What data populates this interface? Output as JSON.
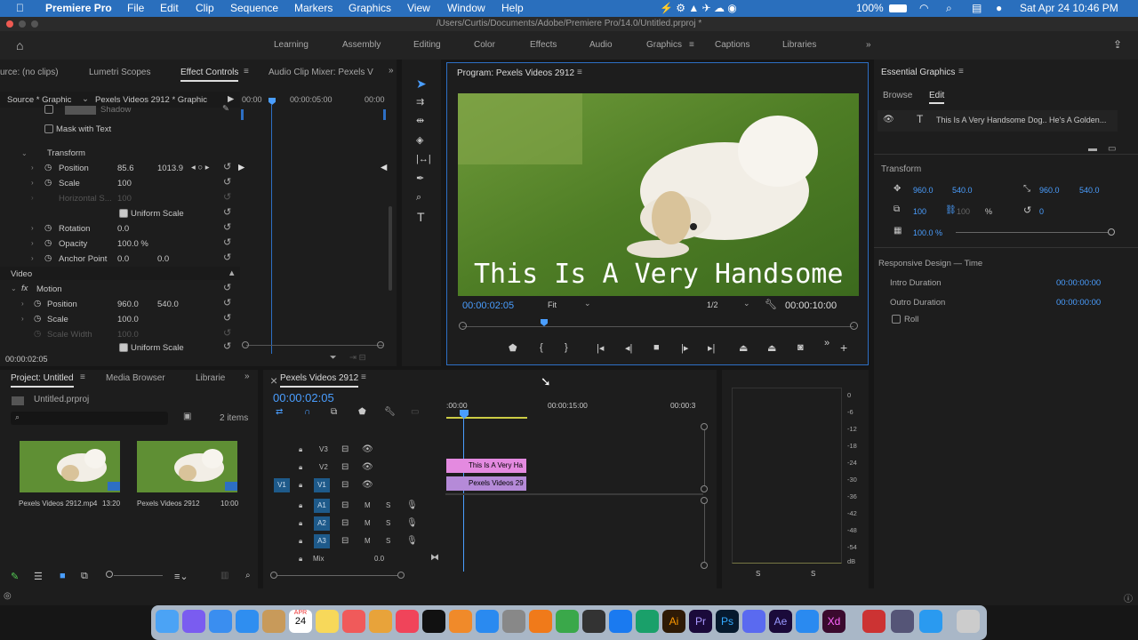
{
  "menubar": {
    "app": "Premiere Pro",
    "items": [
      "File",
      "Edit",
      "Clip",
      "Sequence",
      "Markers",
      "Graphics",
      "View",
      "Window",
      "Help"
    ],
    "battery": "100%",
    "datetime": "Sat Apr 24  10:46 PM"
  },
  "window": {
    "title": "/Users/Curtis/Documents/Adobe/Premiere Pro/14.0/Untitled.prproj *"
  },
  "workspaces": [
    "Learning",
    "Assembly",
    "Editing",
    "Color",
    "Effects",
    "Audio",
    "Graphics",
    "Captions",
    "Libraries"
  ],
  "active_workspace": "Graphics",
  "effect_panel": {
    "tabs": [
      "urce: (no clips)",
      "Lumetri Scopes",
      "Effect Controls",
      "Audio Clip Mixer: Pexels V"
    ],
    "source_label": "Source * Graphic",
    "sequence_label": "Pexels Videos 2912 * Graphic",
    "ruler": [
      "00:00",
      "00:00:05:00",
      "00:00"
    ],
    "shadow": "Shadow",
    "mask_text": "Mask with Text",
    "transform": "Transform",
    "t_position": {
      "label": "Position",
      "x": "85.6",
      "y": "1013.9"
    },
    "t_scale": {
      "label": "Scale",
      "v": "100"
    },
    "t_hscale": {
      "label": "Horizontal S...",
      "v": "100"
    },
    "t_uniform": "Uniform Scale",
    "t_rotation": {
      "label": "Rotation",
      "v": "0.0"
    },
    "t_opacity": {
      "label": "Opacity",
      "v": "100.0 %"
    },
    "t_anchor": {
      "label": "Anchor Point",
      "x": "0.0",
      "y": "0.0"
    },
    "video": "Video",
    "motion": "Motion",
    "m_position": {
      "label": "Position",
      "x": "960.0",
      "y": "540.0"
    },
    "m_scale": {
      "label": "Scale",
      "v": "100.0"
    },
    "m_swidth": {
      "label": "Scale Width",
      "v": "100.0"
    },
    "m_uniform": "Uniform Scale",
    "timecode": "00:00:02:05"
  },
  "program": {
    "title": "Program: Pexels Videos 2912",
    "overlay_text": "This Is A Very Handsome",
    "timecode": "00:00:02:05",
    "fit": "Fit",
    "res": "1/2",
    "duration": "00:00:10:00"
  },
  "essential": {
    "title": "Essential Graphics",
    "tabs": [
      "Browse",
      "Edit"
    ],
    "layer": "This Is A Very Handsome Dog.. He's A Golden...",
    "transform": "Transform",
    "pos_x": "960.0",
    "pos_y": "540.0",
    "anc_x": "960.0",
    "anc_y": "540.0",
    "scale": "100",
    "scale2": "100",
    "pct": "%",
    "rot": "0",
    "opacity": "100.0 %",
    "responsive": "Responsive Design — Time",
    "intro": "Intro Duration",
    "intro_v": "00:00:00:00",
    "outro": "Outro Duration",
    "outro_v": "00:00:00:00",
    "roll": "Roll"
  },
  "project": {
    "tabs": [
      "Project: Untitled",
      "Media Browser",
      "Librarie"
    ],
    "file": "Untitled.prproj",
    "count": "2 items",
    "items": [
      {
        "name": "Pexels Videos 2912.mp4",
        "dur": "13:20"
      },
      {
        "name": "Pexels Videos 2912",
        "dur": "10:00"
      }
    ]
  },
  "timeline": {
    "tab": "Pexels Videos 2912",
    "timecode": "00:00:02:05",
    "ruler": [
      ":00:00",
      "00:00:15:00",
      "00:00:3"
    ],
    "tracks_v": [
      "V3",
      "V2",
      "V1"
    ],
    "tracks_a": [
      "A1",
      "A2",
      "A3"
    ],
    "v1_src": "V1",
    "mix": "Mix",
    "mix_v": "0.0",
    "clip_title": "This Is A Very Ha",
    "clip_video": "Pexels Videos 29",
    "m": "M",
    "s": "S"
  },
  "meter": {
    "labels": [
      "0",
      "-6",
      "-12",
      "-18",
      "-24",
      "-30",
      "-36",
      "-42",
      "-48",
      "-54",
      "dB"
    ],
    "s": "S"
  },
  "dock": {
    "cal_day": "24",
    "cal_month": "APR"
  },
  "colors": {
    "accent": "#4a9eff",
    "menubar": "#2a6fbd",
    "clip_title": "#e48ae0",
    "clip_video": "#b58ad8"
  }
}
